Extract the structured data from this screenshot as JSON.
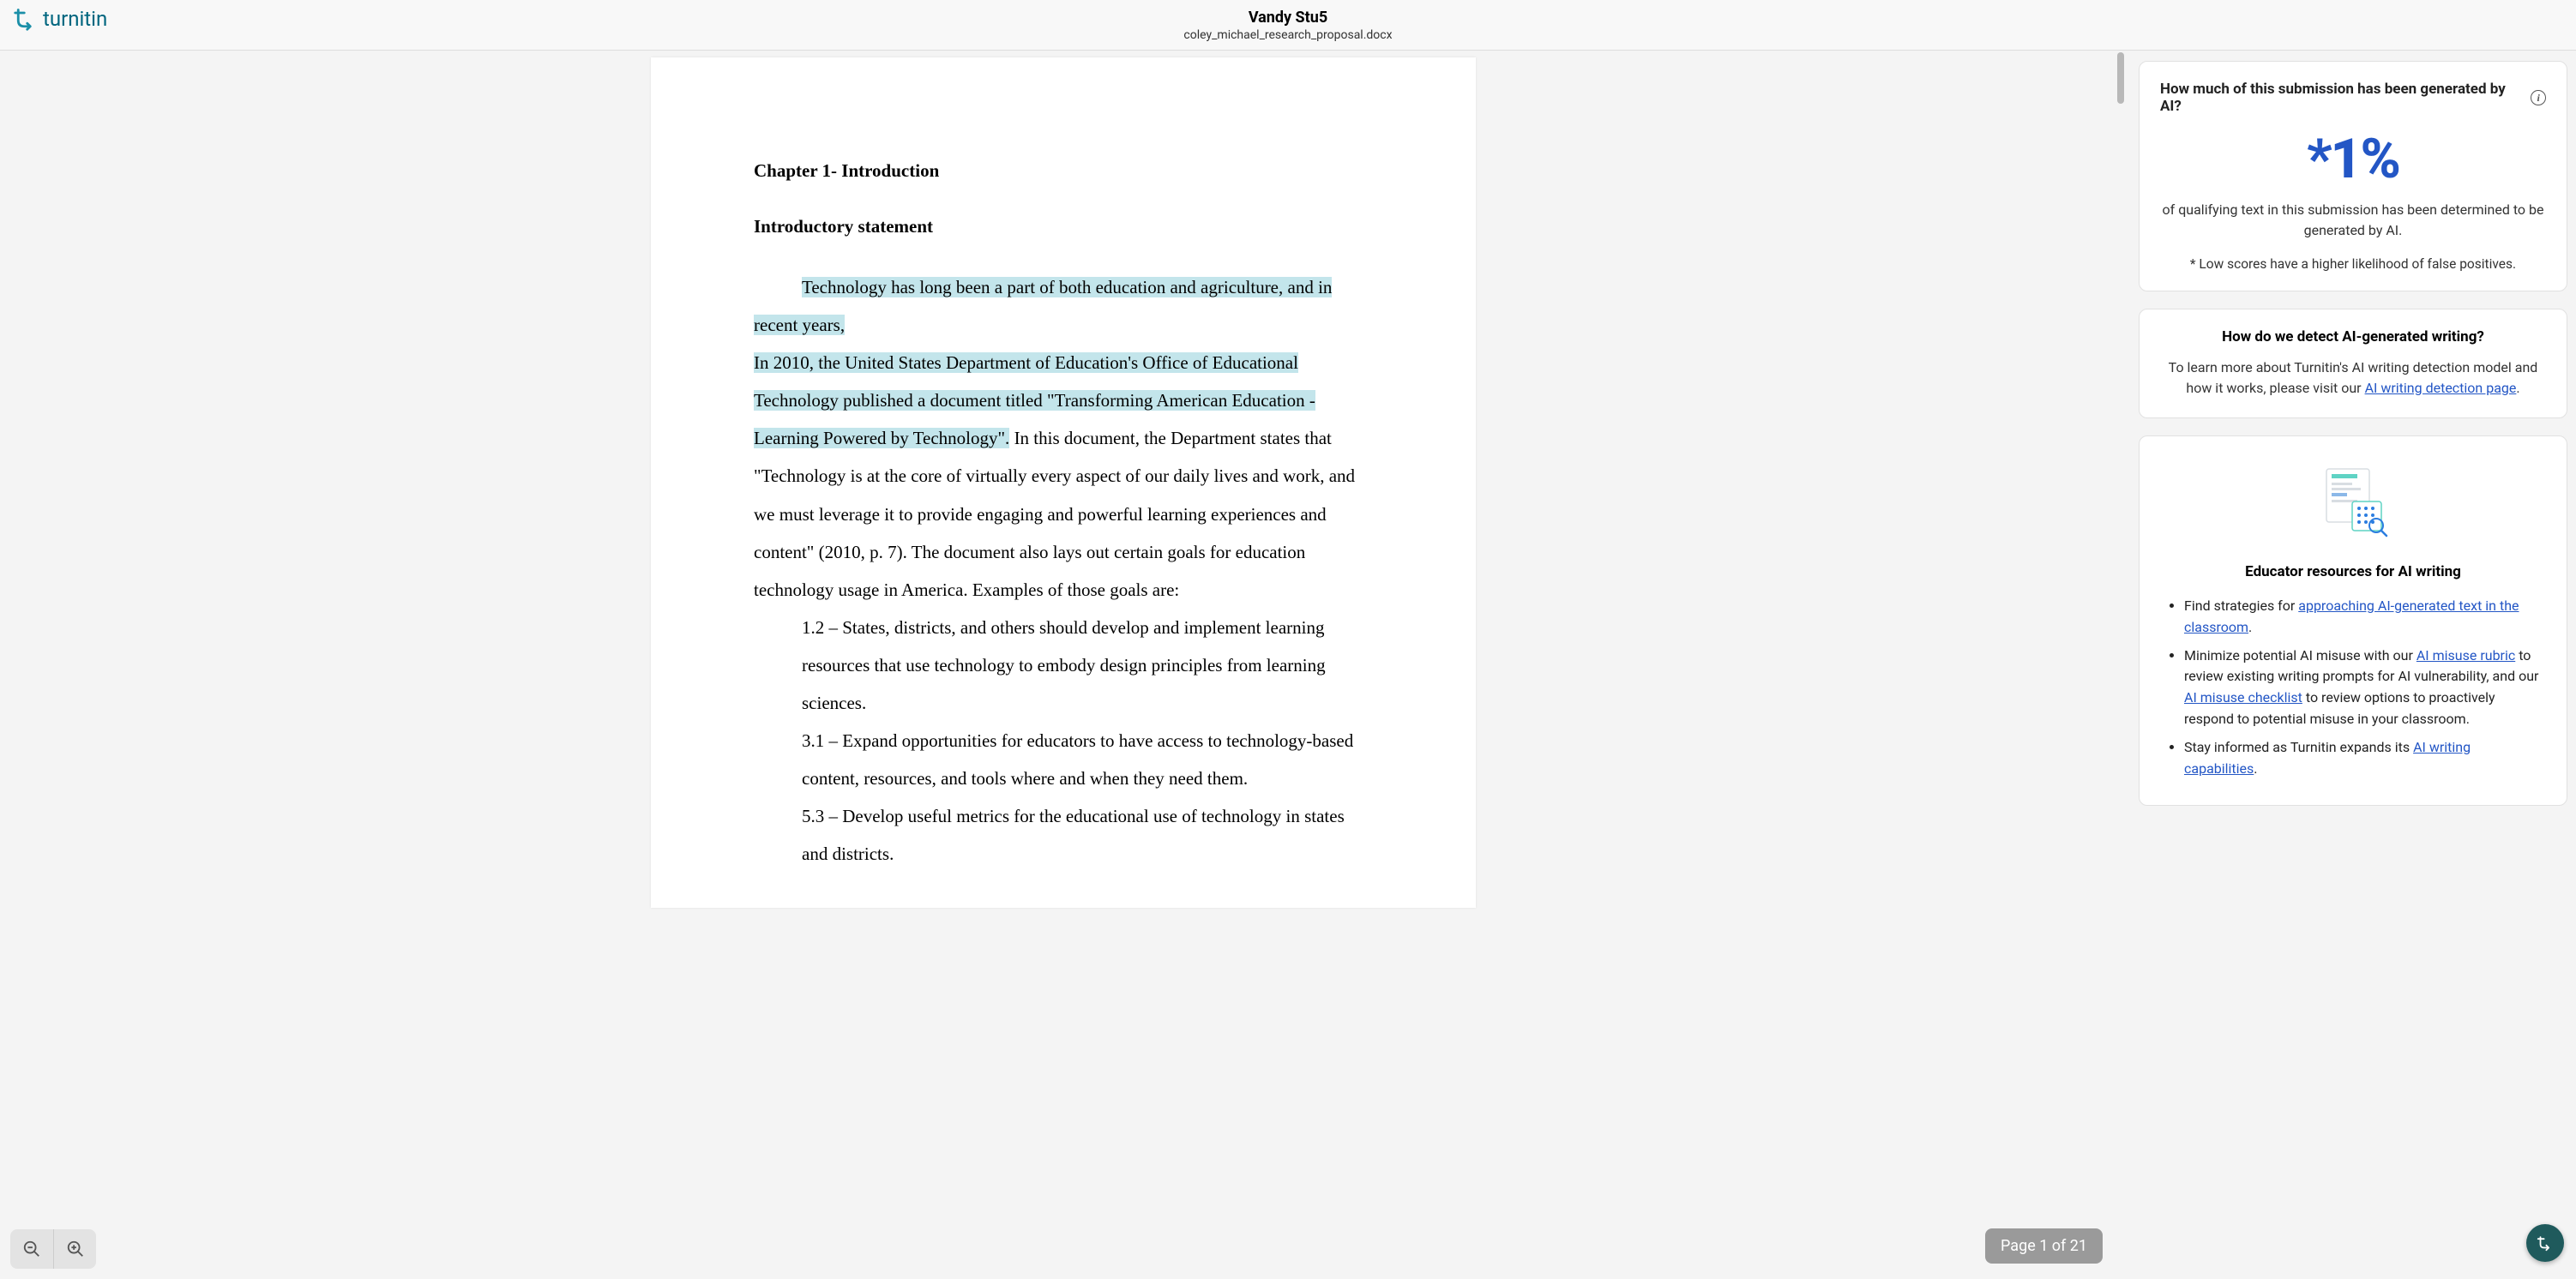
{
  "header": {
    "brand": "turnitin",
    "student_name": "Vandy Stu5",
    "filename": "coley_michael_research_proposal.docx"
  },
  "document": {
    "chapter_heading": "Chapter 1- Introduction",
    "intro_heading": "Introductory statement",
    "para_hl_1": "Technology has long been a part of both education and agriculture, and in recent years,",
    "para_hl_2": "In 2010, the United States Department of Education's Office of Educational Technology published a document titled \"Transforming American Education - Learning Powered by Technology\".",
    "para_rest": " In this document, the Department states that \"Technology is at the core of virtually every aspect of our daily lives and work, and we must leverage it to provide engaging and powerful learning experiences and content\" (2010, p. 7). The document also lays out certain goals for education technology usage in America. Examples of those goals are:",
    "goals": [
      "1.2 – States, districts, and others should develop and implement learning resources that use technology to embody design principles from learning sciences.",
      "3.1 – Expand opportunities for educators to have access to technology-based content, resources, and tools where and when they need them.",
      "5.3 – Develop useful metrics for the educational use of technology in states and districts."
    ]
  },
  "page_indicator": "Page 1 of 21",
  "sidebar": {
    "card1": {
      "title": "How much of this submission has been generated by AI?",
      "percent": "*1%",
      "subtext": "of qualifying text in this submission has been determined to be generated by AI.",
      "note": "* Low scores have a higher likelihood of false positives."
    },
    "card2": {
      "title": "How do we detect AI-generated writing?",
      "text_before": "To learn more about Turnitin's AI writing detection model and how it works, please visit our ",
      "link": "AI writing detection page",
      "text_after": "."
    },
    "card3": {
      "title": "Educator resources for AI writing",
      "items": [
        {
          "before": "Find strategies for ",
          "link1": "approaching AI-generated text in the classroom",
          "after1": "."
        },
        {
          "before": "Minimize potential AI misuse with our ",
          "link1": "AI misuse rubric",
          "mid1": " to review existing writing prompts for AI vulnerability, and our ",
          "link2": "AI misuse checklist",
          "after2": " to review options to proactively respond to potential misuse in your classroom."
        },
        {
          "before": "Stay informed as Turnitin expands its ",
          "link1": "AI writing capabilities",
          "after1": "."
        }
      ]
    }
  }
}
